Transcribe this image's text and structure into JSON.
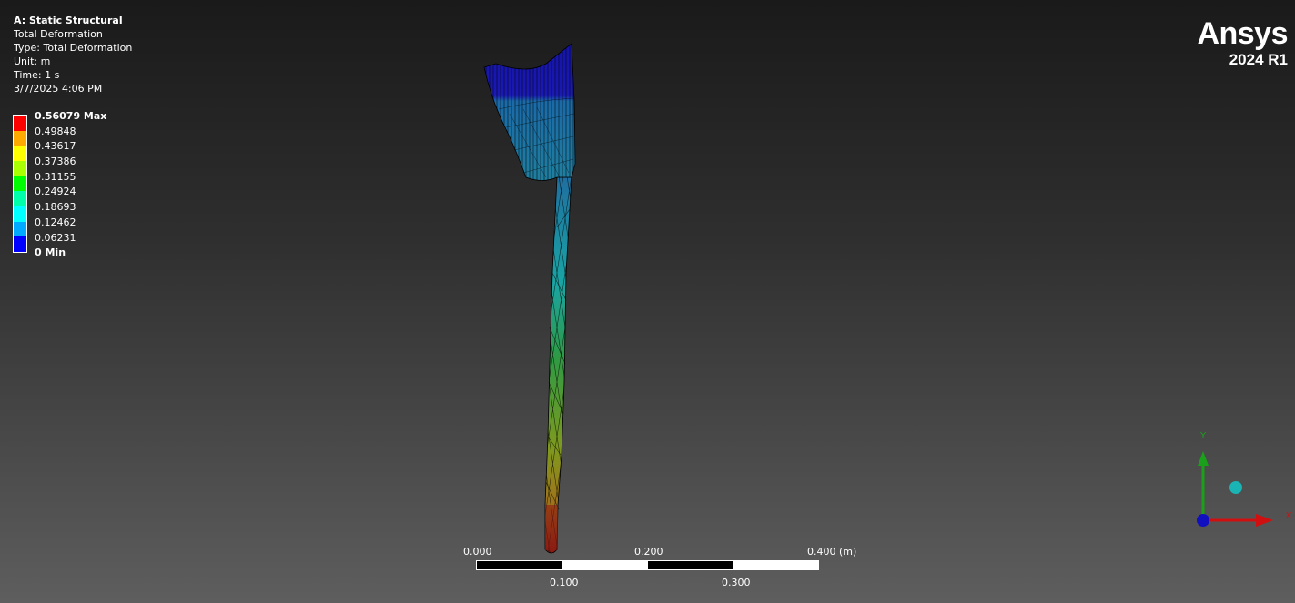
{
  "info": {
    "title": "A: Static Structural",
    "result": "Total Deformation",
    "type": "Type: Total Deformation",
    "unit": "Unit: m",
    "time": "Time: 1 s",
    "date": "3/7/2025 4:06 PM"
  },
  "legend": {
    "max_label": "0.56079 Max",
    "min_label": "0 Min",
    "values": [
      "0.49848",
      "0.43617",
      "0.37386",
      "0.31155",
      "0.24924",
      "0.18693",
      "0.12462",
      "0.06231"
    ],
    "colors": [
      "#ff0000",
      "#ffaa00",
      "#ffff00",
      "#aaff00",
      "#00ff00",
      "#00ffaa",
      "#00ffff",
      "#00aaff",
      "#0000ff"
    ]
  },
  "logo": {
    "brand": "Ansys",
    "version": "2024 R1"
  },
  "scale": {
    "top_labels": [
      "0.000",
      "0.200",
      "0.400 (m)"
    ],
    "bottom_labels": [
      "0.100",
      "0.300"
    ]
  },
  "triad": {
    "y_label": "Y",
    "x_label": "X"
  },
  "colors": {
    "accent_blue": "#00008b"
  }
}
